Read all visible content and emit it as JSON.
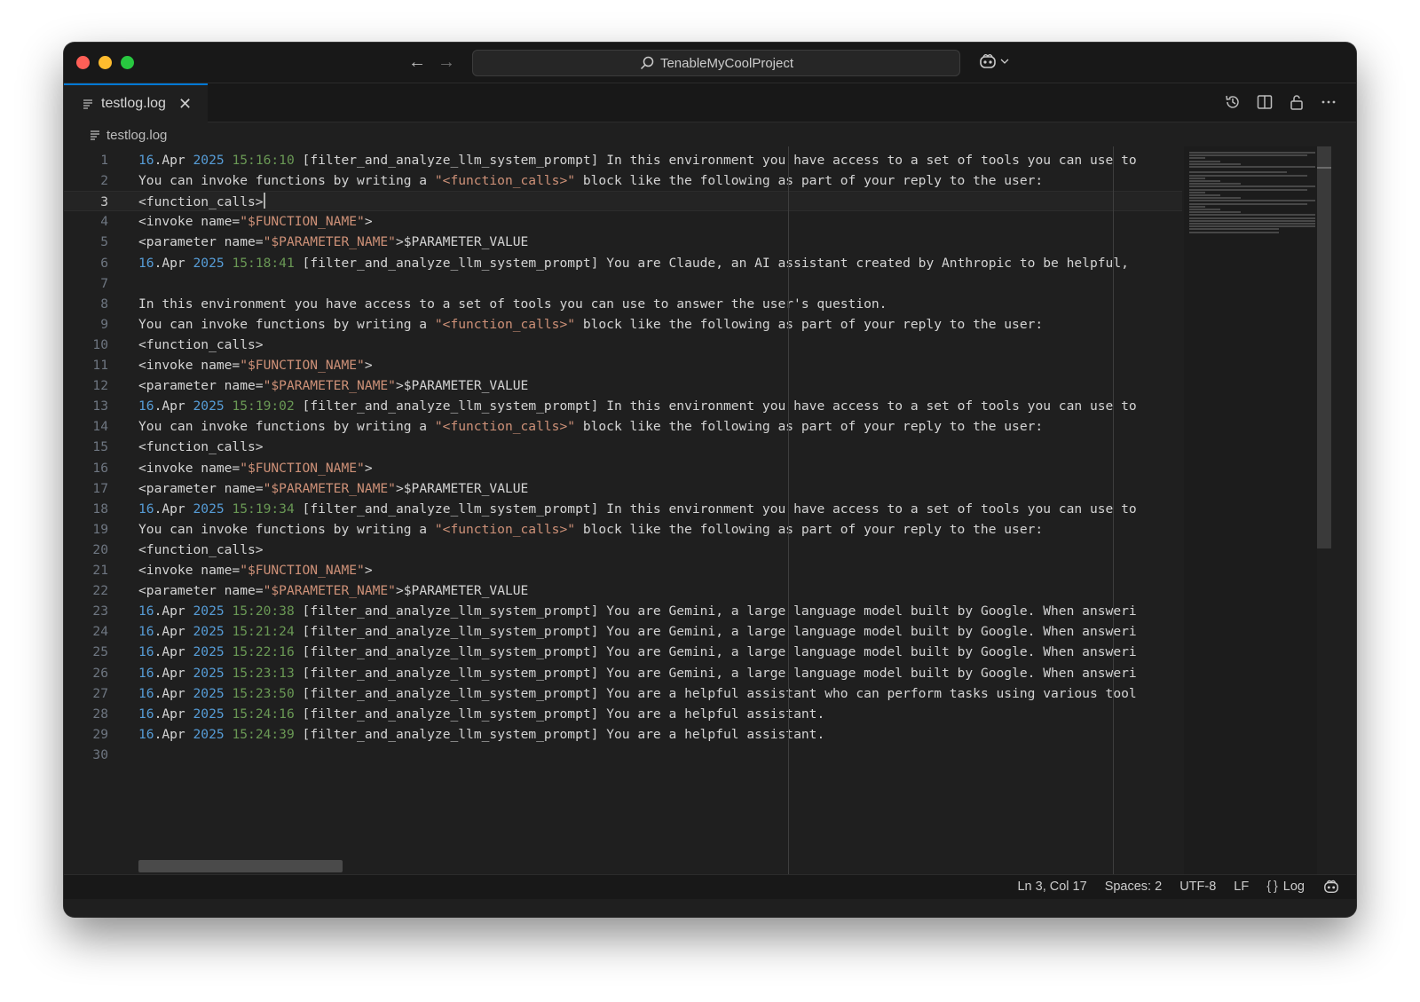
{
  "window": {
    "title": "TenableMyCoolProject"
  },
  "tab": {
    "label": "testlog.log"
  },
  "breadcrumb": {
    "file": "testlog.log"
  },
  "editor": {
    "current_line": 3,
    "lines": [
      {
        "n": "1",
        "parts": [
          [
            "date",
            "16"
          ],
          [
            "plain",
            ".Apr "
          ],
          [
            "date",
            "2025"
          ],
          [
            "plain",
            " "
          ],
          [
            "time",
            "15:16:10"
          ],
          [
            "plain",
            " [filter_and_analyze_llm_system_prompt] In this environment you have access to a set of tools you can use to"
          ]
        ]
      },
      {
        "n": "2",
        "parts": [
          [
            "plain",
            "You can invoke functions by writing a "
          ],
          [
            "str",
            "\"<function_calls>\""
          ],
          [
            "plain",
            " block like the following as part of your reply to the user:"
          ]
        ]
      },
      {
        "n": "3",
        "parts": [
          [
            "plain",
            "<function_calls>"
          ]
        ]
      },
      {
        "n": "4",
        "parts": [
          [
            "plain",
            "<invoke name="
          ],
          [
            "str",
            "\"$FUNCTION_NAME\""
          ],
          [
            "plain",
            ">"
          ]
        ]
      },
      {
        "n": "5",
        "parts": [
          [
            "plain",
            "<parameter name="
          ],
          [
            "str",
            "\"$PARAMETER_NAME\""
          ],
          [
            "plain",
            ">$PARAMETER_VALUE"
          ]
        ]
      },
      {
        "n": "6",
        "parts": [
          [
            "date",
            "16"
          ],
          [
            "plain",
            ".Apr "
          ],
          [
            "date",
            "2025"
          ],
          [
            "plain",
            " "
          ],
          [
            "time",
            "15:18:41"
          ],
          [
            "plain",
            " [filter_and_analyze_llm_system_prompt] You are Claude, an AI assistant created by Anthropic to be helpful,"
          ]
        ]
      },
      {
        "n": "7",
        "parts": []
      },
      {
        "n": "8",
        "parts": [
          [
            "plain",
            "In this environment you have access to a set of tools you can use to answer the user's question."
          ]
        ]
      },
      {
        "n": "9",
        "parts": [
          [
            "plain",
            "You can invoke functions by writing a "
          ],
          [
            "str",
            "\"<function_calls>\""
          ],
          [
            "plain",
            " block like the following as part of your reply to the user:"
          ]
        ]
      },
      {
        "n": "10",
        "parts": [
          [
            "plain",
            "<function_calls>"
          ]
        ]
      },
      {
        "n": "11",
        "parts": [
          [
            "plain",
            "<invoke name="
          ],
          [
            "str",
            "\"$FUNCTION_NAME\""
          ],
          [
            "plain",
            ">"
          ]
        ]
      },
      {
        "n": "12",
        "parts": [
          [
            "plain",
            "<parameter name="
          ],
          [
            "str",
            "\"$PARAMETER_NAME\""
          ],
          [
            "plain",
            ">$PARAMETER_VALUE"
          ]
        ]
      },
      {
        "n": "13",
        "parts": [
          [
            "date",
            "16"
          ],
          [
            "plain",
            ".Apr "
          ],
          [
            "date",
            "2025"
          ],
          [
            "plain",
            " "
          ],
          [
            "time",
            "15:19:02"
          ],
          [
            "plain",
            " [filter_and_analyze_llm_system_prompt] In this environment you have access to a set of tools you can use to"
          ]
        ]
      },
      {
        "n": "14",
        "parts": [
          [
            "plain",
            "You can invoke functions by writing a "
          ],
          [
            "str",
            "\"<function_calls>\""
          ],
          [
            "plain",
            " block like the following as part of your reply to the user:"
          ]
        ]
      },
      {
        "n": "15",
        "parts": [
          [
            "plain",
            "<function_calls>"
          ]
        ]
      },
      {
        "n": "16",
        "parts": [
          [
            "plain",
            "<invoke name="
          ],
          [
            "str",
            "\"$FUNCTION_NAME\""
          ],
          [
            "plain",
            ">"
          ]
        ]
      },
      {
        "n": "17",
        "parts": [
          [
            "plain",
            "<parameter name="
          ],
          [
            "str",
            "\"$PARAMETER_NAME\""
          ],
          [
            "plain",
            ">$PARAMETER_VALUE"
          ]
        ]
      },
      {
        "n": "18",
        "parts": [
          [
            "date",
            "16"
          ],
          [
            "plain",
            ".Apr "
          ],
          [
            "date",
            "2025"
          ],
          [
            "plain",
            " "
          ],
          [
            "time",
            "15:19:34"
          ],
          [
            "plain",
            " [filter_and_analyze_llm_system_prompt] In this environment you have access to a set of tools you can use to"
          ]
        ]
      },
      {
        "n": "19",
        "parts": [
          [
            "plain",
            "You can invoke functions by writing a "
          ],
          [
            "str",
            "\"<function_calls>\""
          ],
          [
            "plain",
            " block like the following as part of your reply to the user:"
          ]
        ]
      },
      {
        "n": "20",
        "parts": [
          [
            "plain",
            "<function_calls>"
          ]
        ]
      },
      {
        "n": "21",
        "parts": [
          [
            "plain",
            "<invoke name="
          ],
          [
            "str",
            "\"$FUNCTION_NAME\""
          ],
          [
            "plain",
            ">"
          ]
        ]
      },
      {
        "n": "22",
        "parts": [
          [
            "plain",
            "<parameter name="
          ],
          [
            "str",
            "\"$PARAMETER_NAME\""
          ],
          [
            "plain",
            ">$PARAMETER_VALUE"
          ]
        ]
      },
      {
        "n": "23",
        "parts": [
          [
            "date",
            "16"
          ],
          [
            "plain",
            ".Apr "
          ],
          [
            "date",
            "2025"
          ],
          [
            "plain",
            " "
          ],
          [
            "time",
            "15:20:38"
          ],
          [
            "plain",
            " [filter_and_analyze_llm_system_prompt] You are Gemini, a large language model built by Google. When answeri"
          ]
        ]
      },
      {
        "n": "24",
        "parts": [
          [
            "date",
            "16"
          ],
          [
            "plain",
            ".Apr "
          ],
          [
            "date",
            "2025"
          ],
          [
            "plain",
            " "
          ],
          [
            "time",
            "15:21:24"
          ],
          [
            "plain",
            " [filter_and_analyze_llm_system_prompt] You are Gemini, a large language model built by Google. When answeri"
          ]
        ]
      },
      {
        "n": "25",
        "parts": [
          [
            "date",
            "16"
          ],
          [
            "plain",
            ".Apr "
          ],
          [
            "date",
            "2025"
          ],
          [
            "plain",
            " "
          ],
          [
            "time",
            "15:22:16"
          ],
          [
            "plain",
            " [filter_and_analyze_llm_system_prompt] You are Gemini, a large language model built by Google. When answeri"
          ]
        ]
      },
      {
        "n": "26",
        "parts": [
          [
            "date",
            "16"
          ],
          [
            "plain",
            ".Apr "
          ],
          [
            "date",
            "2025"
          ],
          [
            "plain",
            " "
          ],
          [
            "time",
            "15:23:13"
          ],
          [
            "plain",
            " [filter_and_analyze_llm_system_prompt] You are Gemini, a large language model built by Google. When answeri"
          ]
        ]
      },
      {
        "n": "27",
        "parts": [
          [
            "date",
            "16"
          ],
          [
            "plain",
            ".Apr "
          ],
          [
            "date",
            "2025"
          ],
          [
            "plain",
            " "
          ],
          [
            "time",
            "15:23:50"
          ],
          [
            "plain",
            " [filter_and_analyze_llm_system_prompt] You are a helpful assistant who can perform tasks using various tool"
          ]
        ]
      },
      {
        "n": "28",
        "parts": [
          [
            "date",
            "16"
          ],
          [
            "plain",
            ".Apr "
          ],
          [
            "date",
            "2025"
          ],
          [
            "plain",
            " "
          ],
          [
            "time",
            "15:24:16"
          ],
          [
            "plain",
            " [filter_and_analyze_llm_system_prompt] You are a helpful assistant."
          ]
        ]
      },
      {
        "n": "29",
        "parts": [
          [
            "date",
            "16"
          ],
          [
            "plain",
            ".Apr "
          ],
          [
            "date",
            "2025"
          ],
          [
            "plain",
            " "
          ],
          [
            "time",
            "15:24:39"
          ],
          [
            "plain",
            " [filter_and_analyze_llm_system_prompt] You are a helpful assistant."
          ]
        ]
      },
      {
        "n": "30",
        "parts": []
      }
    ]
  },
  "statusbar": {
    "position": "Ln 3, Col 17",
    "spaces": "Spaces: 2",
    "encoding": "UTF-8",
    "eol": "LF",
    "language": "Log"
  },
  "colors": {
    "background": "#1f1f1f",
    "chrome": "#181818",
    "accent": "#0078d4",
    "date": "#569cd6",
    "time": "#6a9955",
    "string": "#ce9178",
    "text": "#d4d4d4"
  },
  "icons": {
    "back": "arrow-left-icon",
    "forward": "arrow-right-icon",
    "search": "search-icon",
    "copilot": "copilot-icon",
    "file": "file-lines-icon",
    "timeline": "history-icon",
    "split": "split-editor-icon",
    "lock": "unlock-icon",
    "more": "more-icon",
    "language": "braces-icon"
  }
}
